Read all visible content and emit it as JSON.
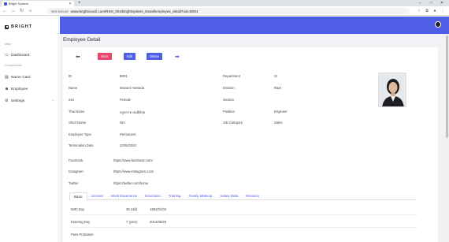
{
  "browser": {
    "tab_title": "Bright System",
    "not_secure": "Not secure",
    "url": "www.brightcoucil.com/RSN_001/BrightSystem_Detail/employee_detail?uid=B001"
  },
  "sidebar": {
    "brand": "BRIGHT",
    "section_main": "Main",
    "section_components": "Components",
    "items": [
      {
        "label": "Dashboard"
      },
      {
        "label": "Name Card"
      },
      {
        "label": "Employee"
      },
      {
        "label": "Settings"
      }
    ]
  },
  "page": {
    "title": "Employee Detail",
    "buttons": {
      "back": "Back",
      "edit": "Edit",
      "delete": "Delete"
    }
  },
  "employee": {
    "left": [
      {
        "label": "ID",
        "value": "B001"
      },
      {
        "label": "Name",
        "value": "Mazumi Yamada"
      },
      {
        "label": "Sex",
        "value": "Female"
      },
      {
        "label": "Thai Name",
        "value": "ทรูทราท สมมีดีสุด"
      },
      {
        "label": "Short Name",
        "value": "NIA"
      },
      {
        "label": "Employee Type",
        "value": "Permanent"
      },
      {
        "label": "Termination Date",
        "value": "20/05/2020"
      }
    ],
    "right": [
      {
        "label": "Department",
        "value": "Sr"
      },
      {
        "label": "Division",
        "value": "R&D"
      },
      {
        "label": "Section",
        "value": ""
      },
      {
        "label": "Position",
        "value": "Engineer"
      },
      {
        "label": "Job Category",
        "value": "Sales"
      }
    ],
    "social": [
      {
        "label": "Facebook",
        "value": "https://www.facebook.com/"
      },
      {
        "label": "Instagram",
        "value": "https://www.instagram.com/"
      },
      {
        "label": "Twitter",
        "value": "https://twitter.com/home"
      }
    ]
  },
  "tabs": [
    "Basic",
    "License",
    "Work Experience",
    "Education",
    "Training",
    "Family Makeup",
    "Salary Data",
    "Revision"
  ],
  "basic": [
    {
      "label": "Birth Day",
      "value1": "36 (old)",
      "value2": "1984/01/02"
    },
    {
      "label": "Entering Day",
      "value1": "7 (year)",
      "value2": "2013/06/29"
    },
    {
      "label": "Pass Probation",
      "value1": "",
      "value2": ""
    }
  ]
}
